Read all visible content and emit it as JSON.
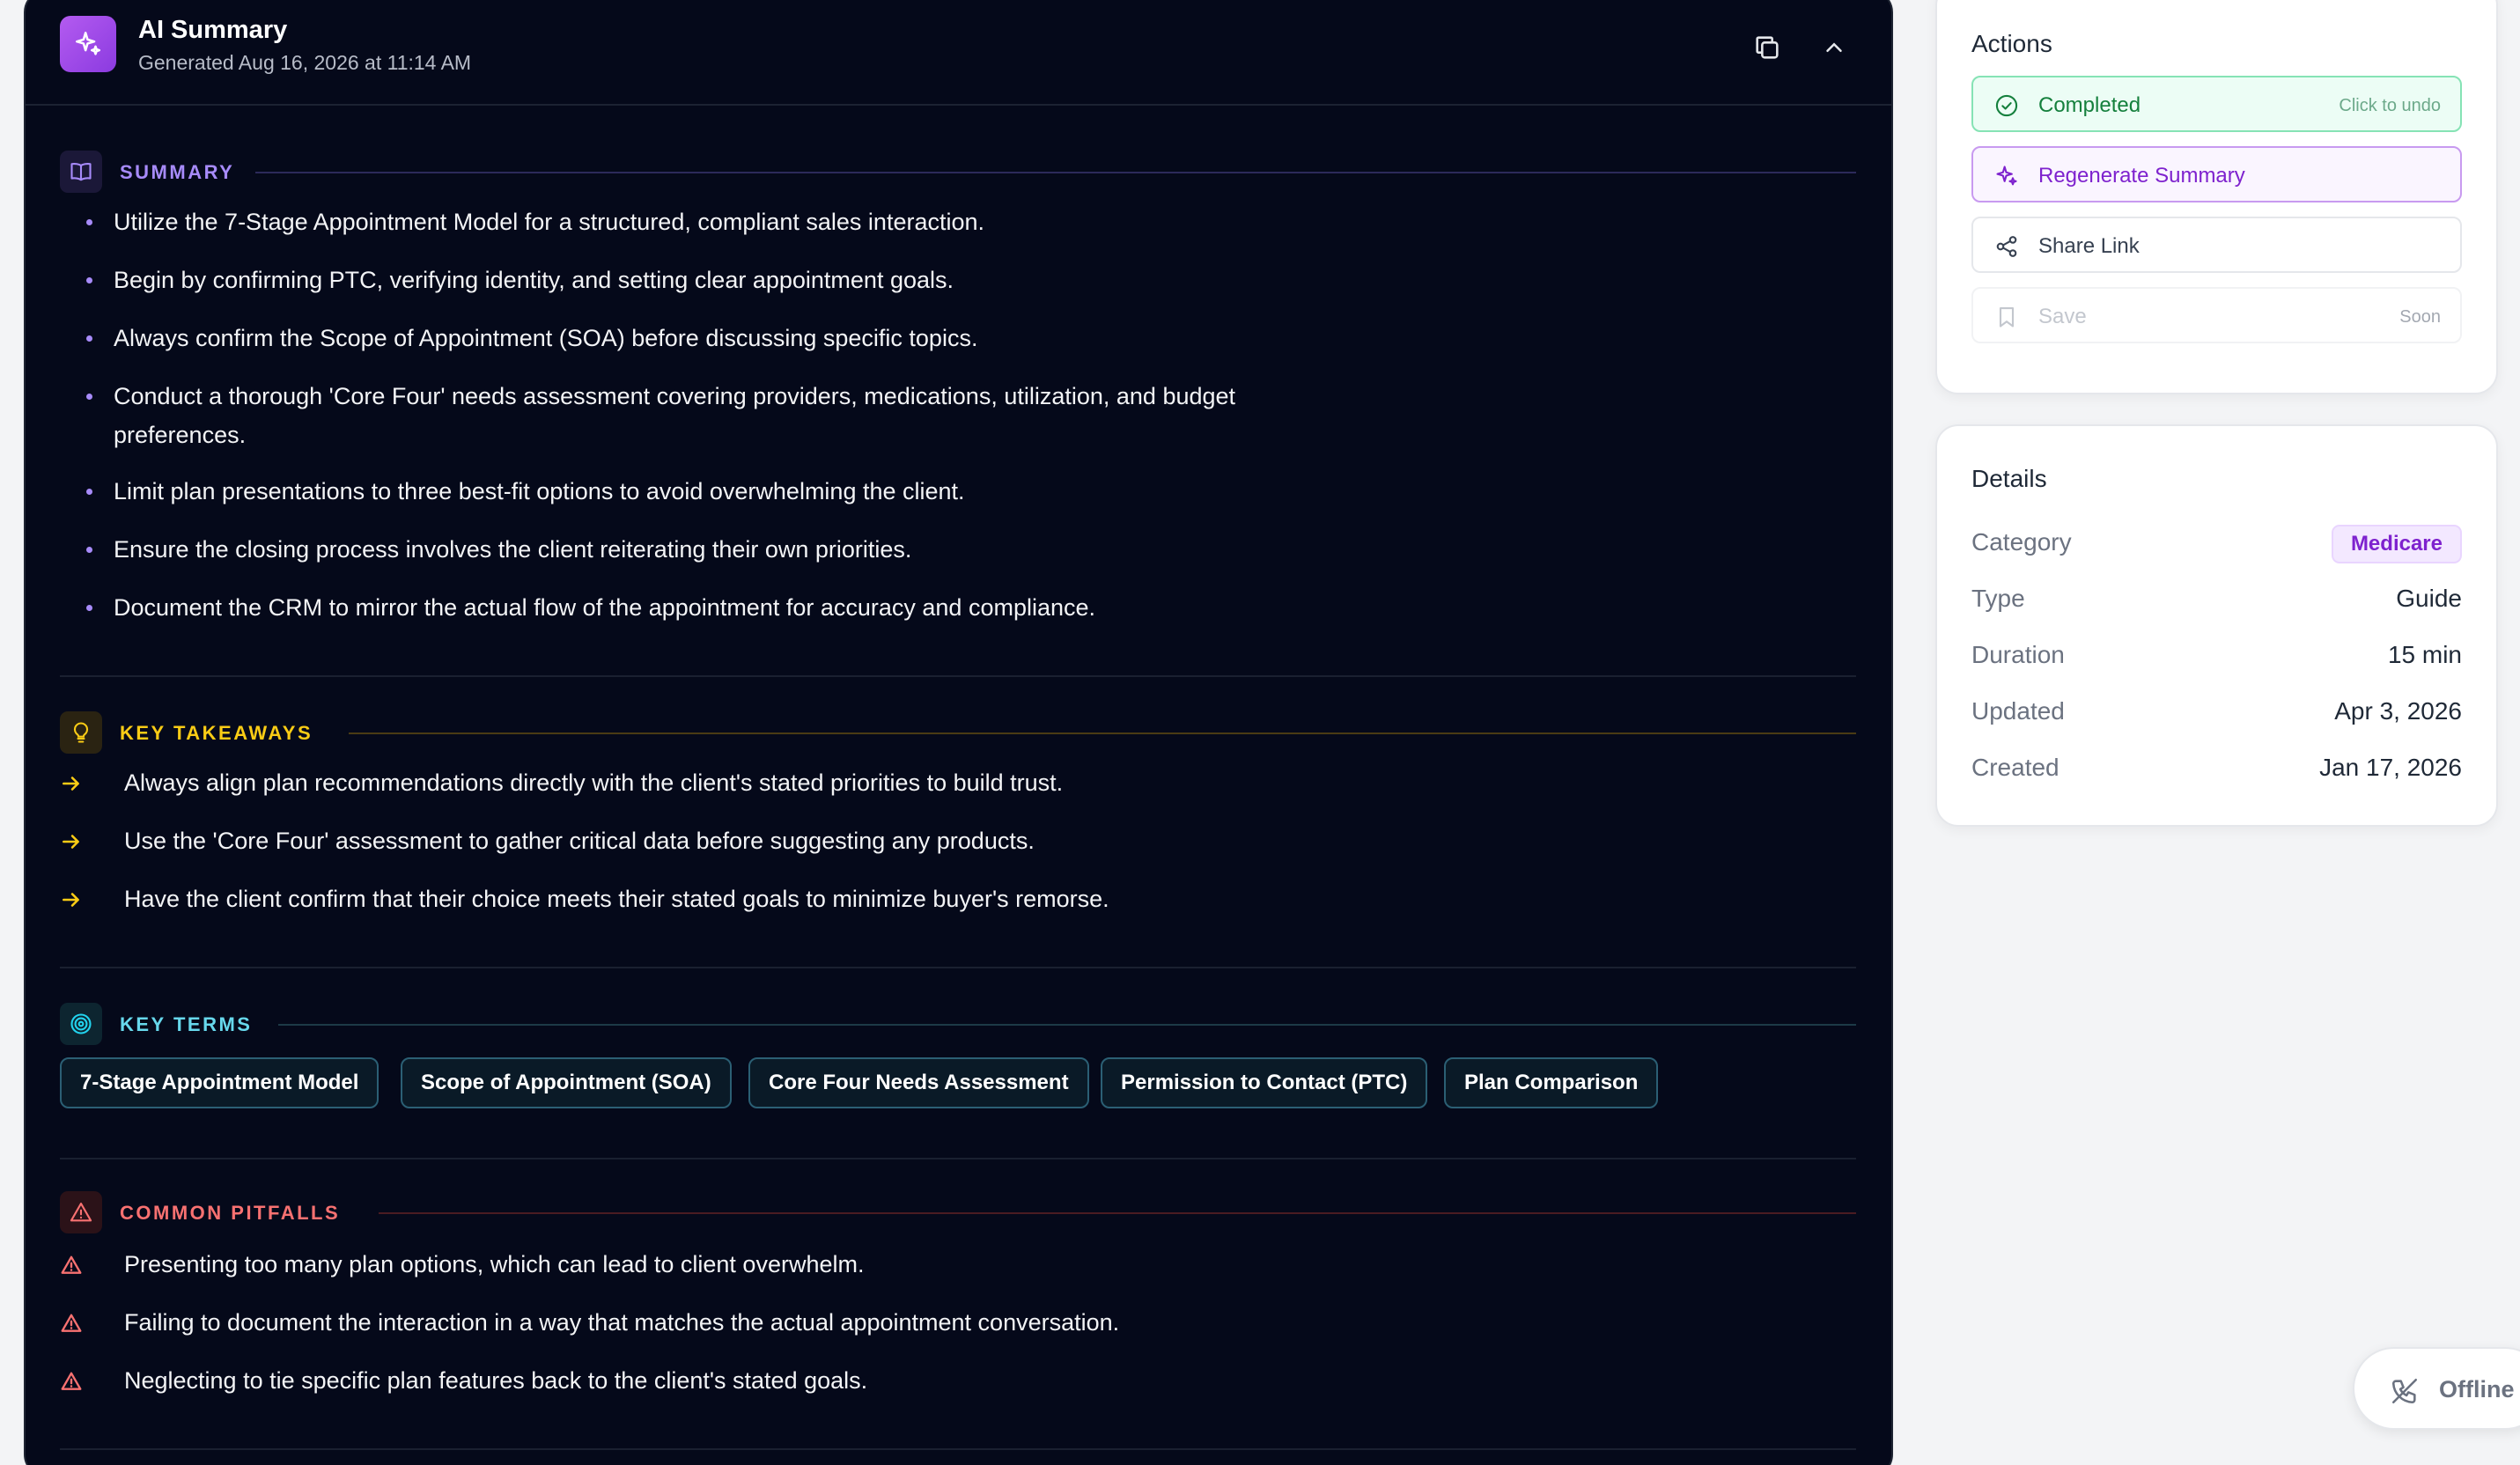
{
  "header": {
    "title": "AI Summary",
    "generated": "Generated Aug 16, 2026 at 11:14 AM"
  },
  "sections": {
    "summary_title": "SUMMARY",
    "takeaways_title": "KEY TAKEAWAYS",
    "terms_title": "KEY TERMS",
    "pitfalls_title": "COMMON PITFALLS"
  },
  "summary": [
    "Utilize the 7-Stage Appointment Model for a structured, compliant sales interaction.",
    "Begin by confirming PTC, verifying identity, and setting clear appointment goals.",
    "Always confirm the Scope of Appointment (SOA) before discussing specific topics.",
    "Conduct a thorough 'Core Four' needs assessment covering providers, medications, utilization, and budget preferences.",
    "Limit plan presentations to three best-fit options to avoid overwhelming the client.",
    "Ensure the closing process involves the client reiterating their own priorities.",
    "Document the CRM to mirror the actual flow of the appointment for accuracy and compliance."
  ],
  "takeaways": [
    "Always align plan recommendations directly with the client's stated priorities to build trust.",
    "Use the 'Core Four' assessment to gather critical data before suggesting any products.",
    "Have the client confirm that their choice meets their stated goals to minimize buyer's remorse."
  ],
  "terms": [
    "7-Stage Appointment Model",
    "Scope of Appointment (SOA)",
    "Core Four Needs Assessment",
    "Permission to Contact (PTC)",
    "Plan Comparison"
  ],
  "pitfalls": [
    "Presenting too many plan options, which can lead to client overwhelm.",
    "Failing to document the interaction in a way that matches the actual appointment conversation.",
    "Neglecting to tie specific plan features back to the client's stated goals."
  ],
  "actions": {
    "title": "Actions",
    "completed_label": "Completed",
    "completed_hint": "Click to undo",
    "regenerate_label": "Regenerate Summary",
    "share_label": "Share Link",
    "save_label": "Save",
    "save_hint": "Soon"
  },
  "details": {
    "title": "Details",
    "category_key": "Category",
    "category_value": "Medicare",
    "type_key": "Type",
    "type_value": "Guide",
    "duration_key": "Duration",
    "duration_value": "15 min",
    "updated_key": "Updated",
    "updated_value": "Apr 3, 2026",
    "created_key": "Created",
    "created_value": "Jan 17, 2026"
  },
  "status": {
    "offline_label": "Offline"
  },
  "colors": {
    "panel_bg": "#05091a",
    "summary_accent": "#a78bfa",
    "takeaways_accent": "#facc15",
    "terms_accent": "#22d3ee",
    "pitfalls_accent": "#f87171",
    "ai_logo": "#b45bf0"
  }
}
